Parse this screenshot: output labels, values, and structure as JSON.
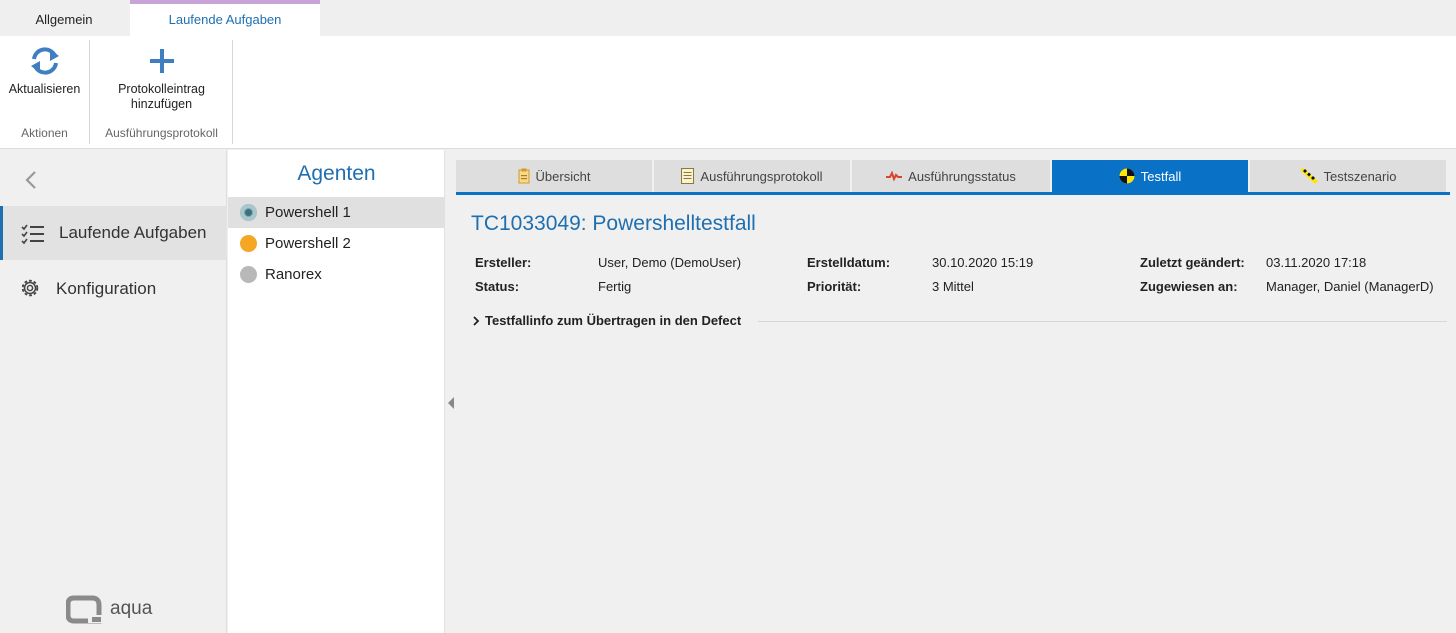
{
  "ribbon": {
    "tabs": [
      {
        "label": "Allgemein",
        "active": false
      },
      {
        "label": "Laufende Aufgaben",
        "active": true
      }
    ],
    "groups": [
      {
        "label": "Aktionen",
        "button": {
          "label": "Aktualisieren",
          "icon": "refresh-icon"
        }
      },
      {
        "label": "Ausführungsprotokoll",
        "button": {
          "label_line1": "Protokolleintrag",
          "label_line2": "hinzufügen",
          "icon": "plus-icon"
        }
      }
    ]
  },
  "nav": {
    "items": [
      {
        "label": "Laufende Aufgaben",
        "icon": "checklist-icon",
        "active": true
      },
      {
        "label": "Konfiguration",
        "icon": "gear-icon",
        "active": false
      }
    ],
    "logo": "aqua"
  },
  "agents": {
    "title": "Agenten",
    "items": [
      {
        "label": "Powershell 1",
        "status_color": "#7aa5b0",
        "selected": true
      },
      {
        "label": "Powershell 2",
        "status_color": "#f5a623",
        "selected": false
      },
      {
        "label": "Ranorex",
        "status_color": "#b8b8b8",
        "selected": false
      }
    ]
  },
  "detail": {
    "tabs": [
      {
        "label": "Übersicht",
        "icon": "clipboard-icon"
      },
      {
        "label": "Ausführungsprotokoll",
        "icon": "document-icon"
      },
      {
        "label": "Ausführungsstatus",
        "icon": "status-wave-icon"
      },
      {
        "label": "Testfall",
        "icon": "crash-test-icon"
      },
      {
        "label": "Testszenario",
        "icon": "scenario-icon"
      }
    ],
    "title": "TC1033049: Powershelltestfall",
    "fields": {
      "creator_label": "Ersteller:",
      "creator_value": "User, Demo (DemoUser)",
      "status_label": "Status:",
      "status_value": "Fertig",
      "created_label": "Erstelldatum:",
      "created_value": "30.10.2020 15:19",
      "priority_label": "Priorität:",
      "priority_value": "3 Mittel",
      "modified_label": "Zuletzt geändert:",
      "modified_value": "03.11.2020 17:18",
      "assigned_label": "Zugewiesen an:",
      "assigned_value": "Manager, Daniel (ManagerD)"
    },
    "defect_section": "Testfallinfo zum Übertragen in den Defect"
  },
  "colors": {
    "accent": "#1f6fb0",
    "active_tab": "#0a72c6",
    "ribbon_tab_indicator": "#c8a3d8"
  }
}
